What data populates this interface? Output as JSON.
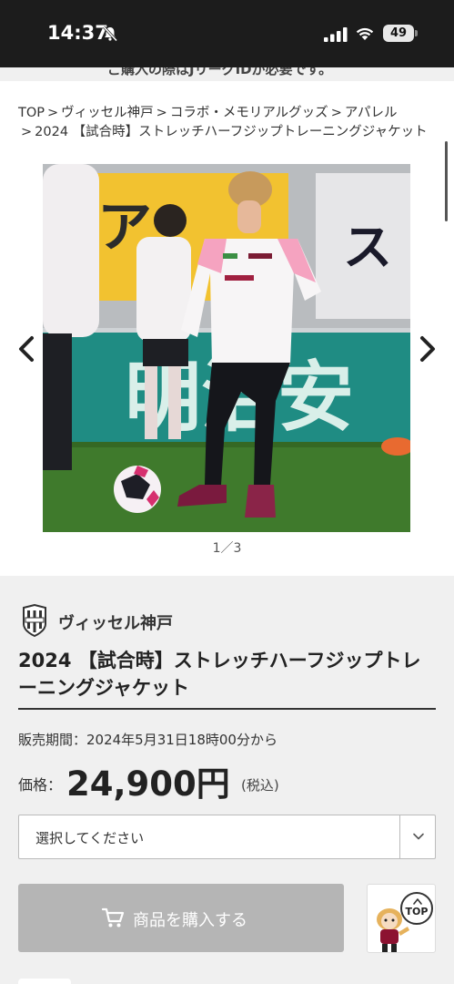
{
  "status_bar": {
    "time": "14:37",
    "battery": "49"
  },
  "notice": {
    "text": "ご購入の際はJリーグIDが必要です。"
  },
  "breadcrumb": {
    "items": [
      "TOP",
      "ヴィッセル神戸",
      "コラボ・メモリアルグッズ",
      "アパレル",
      "2024 【試合時】ストレッチハーフジップトレーニングジャケット"
    ],
    "separator": ">"
  },
  "gallery": {
    "counter": "1／3",
    "colors": {
      "pitch": "#3f7a2c",
      "board_teal": "#1f8c83",
      "board_yellow": "#f2c230"
    }
  },
  "product": {
    "club_name": "ヴィッセル神戸",
    "title": "2024 【試合時】ストレッチハーフジップトレーニングジャケット",
    "sale_period": "販売期間：2024年5月31日18時00分から",
    "price_label": "価格：",
    "price_value": "24,900円",
    "price_tax": "(税込)",
    "select_placeholder": "選択してください",
    "buy_label": "商品を購入する",
    "top_label": "TOP"
  },
  "colors": {
    "club_crimson": "#8c1231",
    "buy_disabled": "#b5b5b5",
    "panel_bg": "#f0f0f0"
  }
}
